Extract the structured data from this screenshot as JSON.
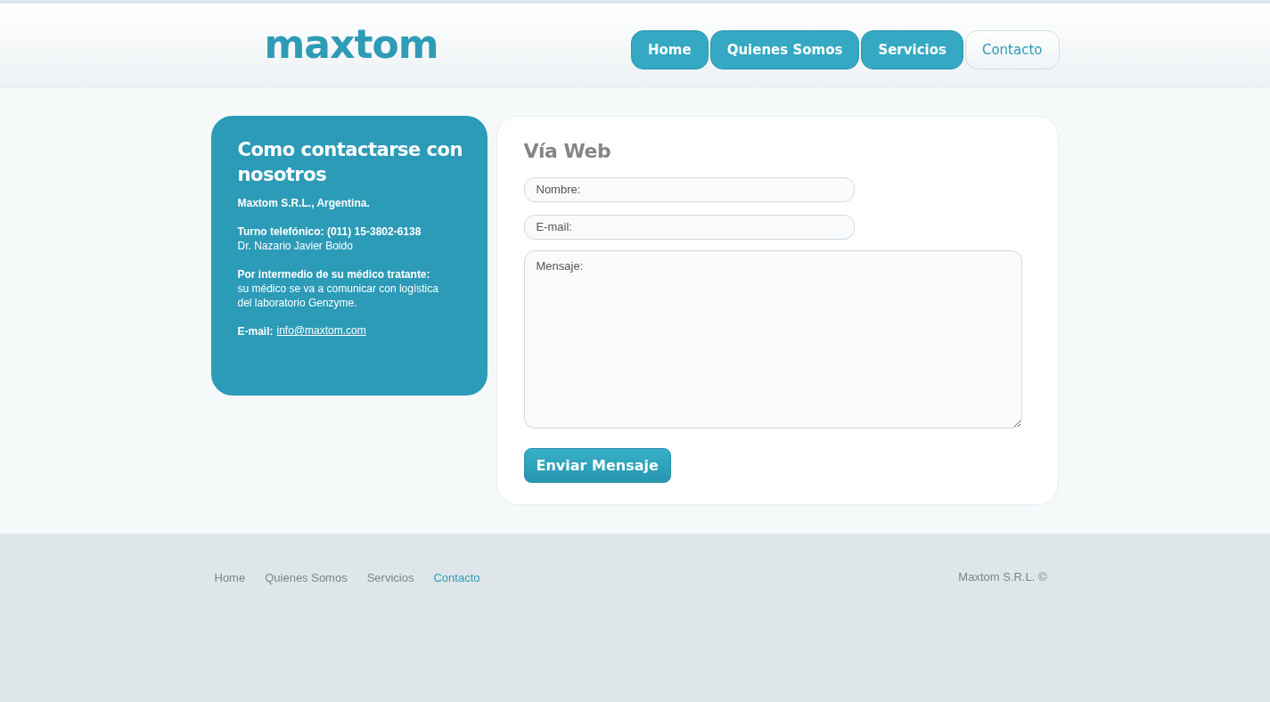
{
  "header": {
    "logo": "maxtom",
    "nav": [
      {
        "label": "Home",
        "selected": false
      },
      {
        "label": "Quienes Somos",
        "selected": false
      },
      {
        "label": "Servicios",
        "selected": false
      },
      {
        "label": "Contacto",
        "selected": true
      }
    ]
  },
  "info_card": {
    "title": "Como contactarse con nosotros",
    "paragraphs": [
      {
        "lines": [
          {
            "kind": "bold",
            "text": "Maxtom S.R.L., Argentina."
          }
        ]
      },
      {
        "lines": [
          {
            "kind": "bold",
            "text": "Turno telefónico: (011) 15-3802-6138"
          },
          {
            "kind": "plain",
            "text": "Dr. Nazario Javier Boido"
          }
        ]
      },
      {
        "lines": [
          {
            "kind": "bold",
            "text": "Por intermedio de su médico tratante:"
          },
          {
            "kind": "plain",
            "text": "su médico se va a comunicar con logística"
          },
          {
            "kind": "plain",
            "text": "del laboratorio Genzyme."
          }
        ]
      },
      {
        "lines": [
          {
            "kind": "email",
            "label": "E-mail:",
            "link": "info@maxtom.com"
          }
        ]
      }
    ]
  },
  "form": {
    "title": "Vía Web",
    "fields": [
      {
        "kind": "line",
        "placeholder": "Nombre:"
      },
      {
        "kind": "line",
        "placeholder": "E-mail:"
      },
      {
        "kind": "area",
        "placeholder": "Mensaje:"
      }
    ],
    "submit": "Enviar Mensaje"
  },
  "footer": {
    "links": [
      {
        "label": "Home",
        "selected": false
      },
      {
        "label": "Quienes Somos",
        "selected": false
      },
      {
        "label": "Servicios",
        "selected": false
      },
      {
        "label": "Contacto",
        "selected": true
      }
    ],
    "copyright": "Maxtom S.R.L. ©"
  }
}
